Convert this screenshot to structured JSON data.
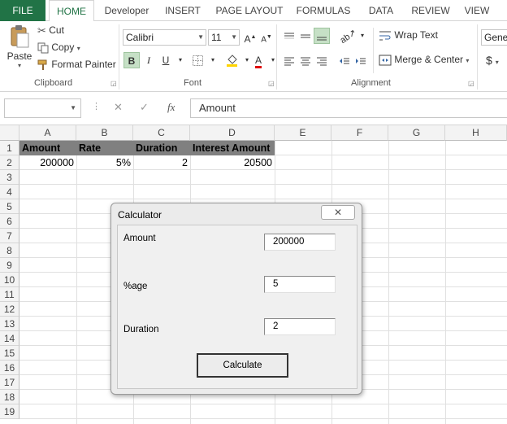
{
  "ribbon_tabs": [
    "FILE",
    "HOME",
    "Developer",
    "INSERT",
    "PAGE LAYOUT",
    "FORMULAS",
    "DATA",
    "REVIEW",
    "VIEW"
  ],
  "clipboard": {
    "paste": "Paste",
    "cut": "Cut",
    "copy": "Copy",
    "format_painter": "Format Painter",
    "group_label": "Clipboard"
  },
  "font": {
    "name": "Calibri",
    "size": "11",
    "group_label": "Font"
  },
  "alignment": {
    "wrap_text": "Wrap Text",
    "merge_center": "Merge & Center",
    "group_label": "Alignment"
  },
  "number": {
    "format": "Gener",
    "currency": "$"
  },
  "formula_bar": {
    "name_box": "",
    "cancel": "✕",
    "enter": "✓",
    "fx": "fx",
    "content": "Amount"
  },
  "sheet": {
    "columns": [
      "A",
      "B",
      "C",
      "D",
      "E",
      "F",
      "G",
      "H"
    ],
    "rows": [
      "1",
      "2",
      "3",
      "4",
      "5",
      "6",
      "7",
      "8",
      "9",
      "10",
      "11",
      "12",
      "13",
      "14",
      "15",
      "16",
      "17",
      "18",
      "19"
    ],
    "row1": [
      "Amount",
      "Rate",
      "Duration",
      "Interest Amount"
    ],
    "row2": [
      "200000",
      "5%",
      "2",
      "20500"
    ]
  },
  "dialog": {
    "title": "Calculator",
    "close": "✕",
    "amount_label": "Amount",
    "amount_value": "200000",
    "rate_label": "%age",
    "rate_value": "5",
    "duration_label": "Duration",
    "duration_value": "2",
    "calculate": "Calculate"
  },
  "colors": {
    "file_tab": "#217346",
    "header_fill": "#808080"
  }
}
